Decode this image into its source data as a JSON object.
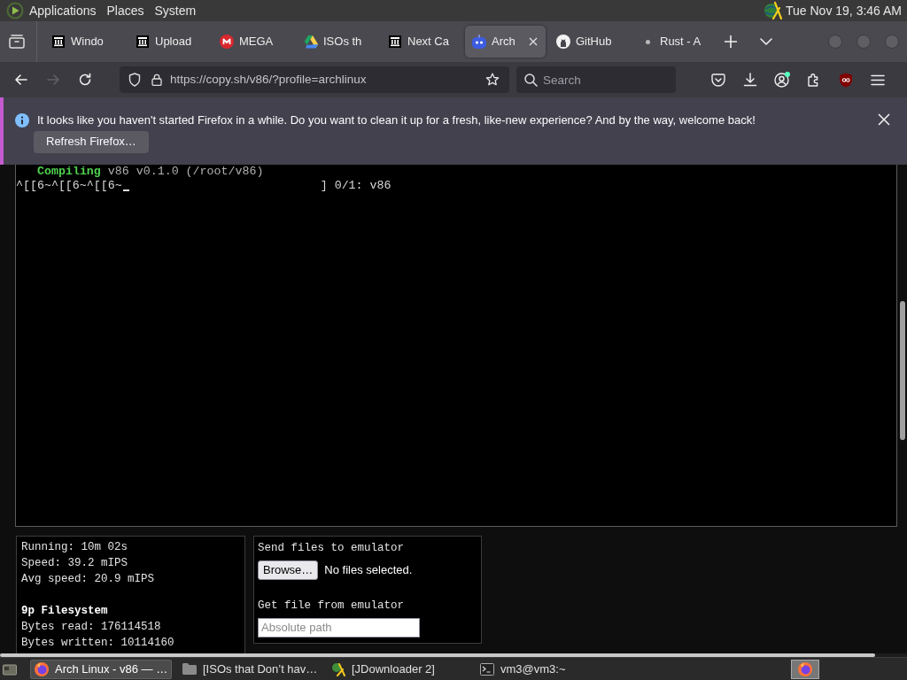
{
  "top_panel": {
    "menus": [
      "Applications",
      "Places",
      "System"
    ],
    "clock": "Tue Nov 19, 3:46 AM"
  },
  "tabs": [
    {
      "kind": "archive",
      "title": "Windo",
      "selected": false
    },
    {
      "kind": "archive",
      "title": "Upload",
      "selected": false
    },
    {
      "kind": "mega",
      "title": "MEGA",
      "selected": false
    },
    {
      "kind": "drive",
      "title": "ISOs th",
      "selected": false
    },
    {
      "kind": "archive",
      "title": "Next Ca",
      "selected": false
    },
    {
      "kind": "robot",
      "title": "Arch",
      "selected": true
    },
    {
      "kind": "github",
      "title": "GitHub",
      "selected": false
    },
    {
      "kind": "dot",
      "title": "Rust - A",
      "selected": false
    }
  ],
  "nav": {
    "buttons": [
      {
        "kind": "back",
        "disabled": false
      },
      {
        "kind": "forward",
        "disabled": true
      },
      {
        "kind": "reload",
        "disabled": false
      }
    ],
    "url": "https://copy.sh/v86/?profile=archlinux",
    "search": {
      "placeholder": "Search"
    }
  },
  "notification": {
    "message": "It looks like you haven't started Firefox in a while. Do you want to clean it up for a fresh, like-new experience? And by the way, welcome back!",
    "button": "Refresh Firefox…"
  },
  "terminal": {
    "lines": [
      {
        "kind": "compile",
        "label": "Compiling",
        "text": "v86 v0.1.0 (/root/v86)"
      },
      {
        "kind": "input",
        "text": "^[[6~^[[6~^[[6~",
        "progress": "] 0/1: v86"
      }
    ]
  },
  "stats": {
    "lines": [
      "Running: 10m 02s",
      "Speed: 39.2 mIPS",
      "Avg speed: 20.9 mIPS"
    ],
    "filesystem_title": "9p Filesystem",
    "filesystem_lines": [
      "Bytes read: 176114518",
      "Bytes written: 10114160"
    ]
  },
  "files": {
    "send_label": "Send files to emulator",
    "browse_button": "Browse…",
    "file_status": "No files selected.",
    "get_label": "Get file from emulator",
    "path": {
      "placeholder": "Absolute path"
    }
  },
  "taskbar": {
    "tasks": [
      {
        "kind": "firefox",
        "title": "Arch Linux - v86 — …",
        "selected": true
      },
      {
        "kind": "folder",
        "title": "[ISOs that Don’t hav…",
        "selected": false
      },
      {
        "kind": "jdownloader",
        "title": "[JDownloader 2]",
        "selected": false
      },
      {
        "kind": "terminal",
        "title": "vm3@vm3:~",
        "selected": false
      }
    ],
    "tray": [
      {
        "kind": "firefox",
        "selected": true
      }
    ]
  }
}
